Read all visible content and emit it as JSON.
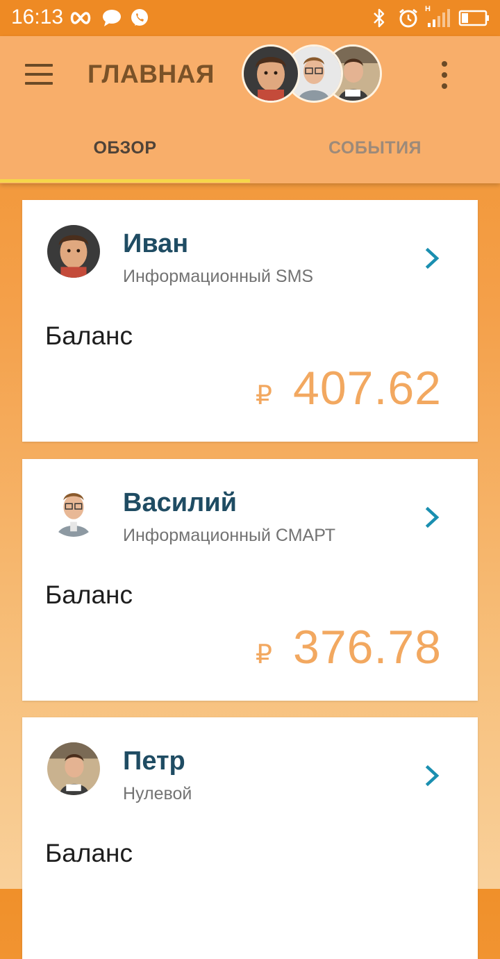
{
  "status_bar": {
    "time": "16:13",
    "left_icons": [
      "infinity-icon",
      "chat-bubble-icon",
      "viber-icon"
    ],
    "right_icons": [
      "bluetooth-icon",
      "alarm-icon",
      "signal-icon",
      "battery-icon"
    ],
    "signal_label": "H"
  },
  "app_bar": {
    "title": "ГЛАВНАЯ",
    "menu_icon": "hamburger-menu-icon",
    "overflow_icon": "more-vert-icon",
    "avatar_names": [
      "Иван",
      "Василий",
      "Петр"
    ]
  },
  "tabs": [
    {
      "label": "ОБЗОР",
      "selected": true
    },
    {
      "label": "СОБЫТИЯ",
      "selected": false
    }
  ],
  "colors": {
    "accent": "#f2a860",
    "name": "#1f4c63",
    "chevron": "#1a8fb0",
    "tab_indicator": "#f6d64a",
    "status_bar": "#ee8a24",
    "app_bar": "#f8ae6a"
  },
  "children": [
    {
      "name": "Иван",
      "plan": "Информационный SMS",
      "balance_label": "Баланс",
      "currency": "₽",
      "amount": "407.62"
    },
    {
      "name": "Василий",
      "plan": "Информационный СМАРТ",
      "balance_label": "Баланс",
      "currency": "₽",
      "amount": "376.78"
    },
    {
      "name": "Петр",
      "plan": "Нулевой",
      "balance_label": "Баланс",
      "currency": "₽",
      "amount": ""
    }
  ]
}
